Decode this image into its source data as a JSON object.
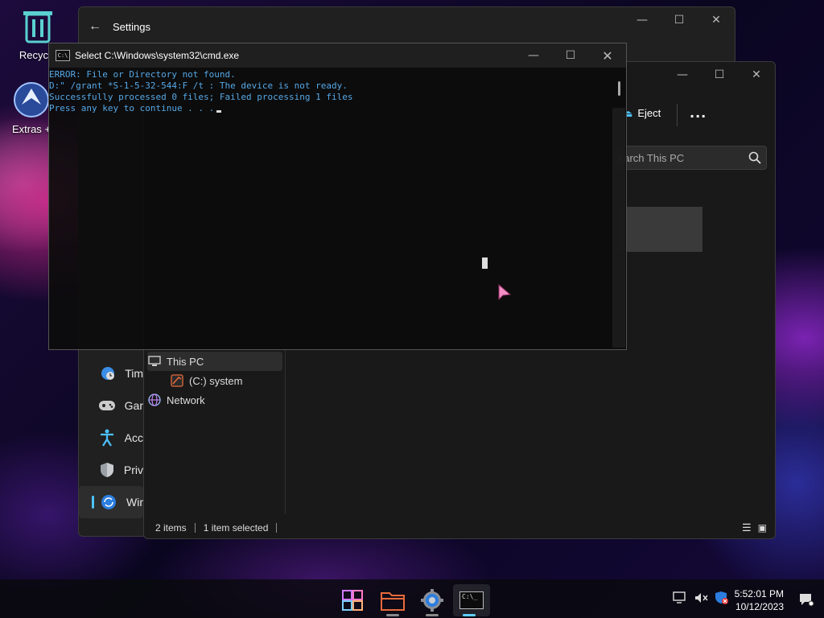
{
  "desktop": {
    "icons": [
      {
        "label": "Recycle"
      },
      {
        "label": "Extras +"
      }
    ]
  },
  "settings": {
    "title": "Settings",
    "nav_items": [
      {
        "label": "Tim"
      },
      {
        "label": "Gar"
      },
      {
        "label": "Acc"
      },
      {
        "label": "Priv"
      },
      {
        "label": "Wir"
      }
    ]
  },
  "explorer": {
    "eject_label": "Eject",
    "more_label": "...",
    "search_placeholder": "earch This PC",
    "sidebar": [
      {
        "label": "This PC"
      },
      {
        "label": "(C:) system"
      },
      {
        "label": "Network"
      }
    ],
    "status": {
      "items": "2 items",
      "selected": "1 item selected"
    }
  },
  "cmd": {
    "title": "Select C:\\Windows\\system32\\cmd.exe",
    "lines": [
      "ERROR: File or Directory not found.",
      "D:\" /grant *S-1-5-32-544:F /t : The device is not ready.",
      "Successfully processed 0 files; Failed processing 1 files",
      "Press any key to continue . . ."
    ],
    "icon_text": "C:\\"
  },
  "taskbar": {
    "time": "5:52:01 PM",
    "date": "10/12/2023",
    "cmd_icon_text": "C:\\_"
  },
  "colors": {
    "accent": "#4cc2ff",
    "cmd_text": "#56a8e6",
    "folder": "#e86a3a"
  }
}
